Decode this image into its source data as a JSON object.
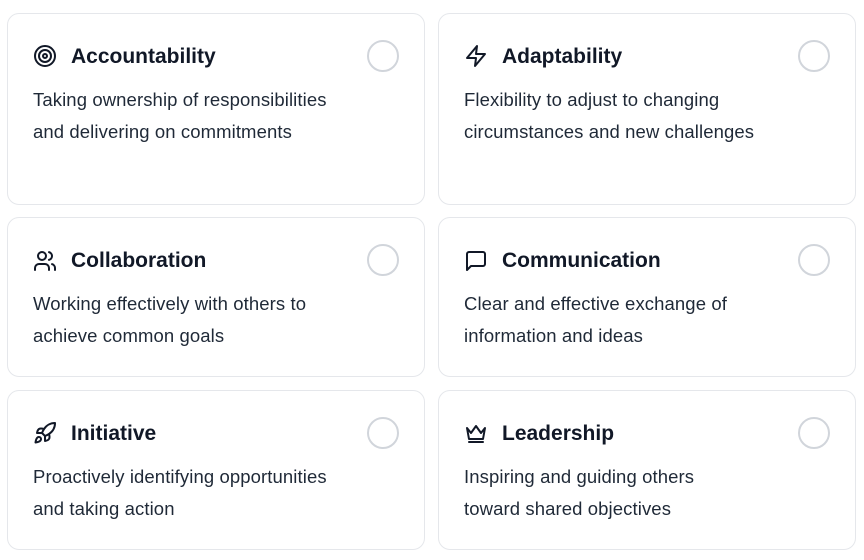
{
  "cards": [
    {
      "title": "Accountability",
      "icon": "target-icon",
      "description": "Taking ownership of responsibilities and delivering on commitments",
      "selected": false
    },
    {
      "title": "Adaptability",
      "icon": "lightning-bolt-icon",
      "description": "Flexibility to adjust to changing circumstances and new challenges",
      "selected": false
    },
    {
      "title": "Collaboration",
      "icon": "users-icon",
      "description": "Working effectively with others to achieve common goals",
      "selected": false
    },
    {
      "title": "Communication",
      "icon": "message-square-icon",
      "description": "Clear and effective exchange of information and ideas",
      "selected": false
    },
    {
      "title": "Initiative",
      "icon": "rocket-icon",
      "description": "Proactively identifying opportunities and taking action",
      "selected": false
    },
    {
      "title": "Leadership",
      "icon": "crown-icon",
      "description": "Inspiring and guiding others toward shared objectives",
      "selected": false
    }
  ],
  "colors": {
    "border": "#e5e7eb",
    "text": "#111827",
    "radio_border": "#d1d5db"
  }
}
